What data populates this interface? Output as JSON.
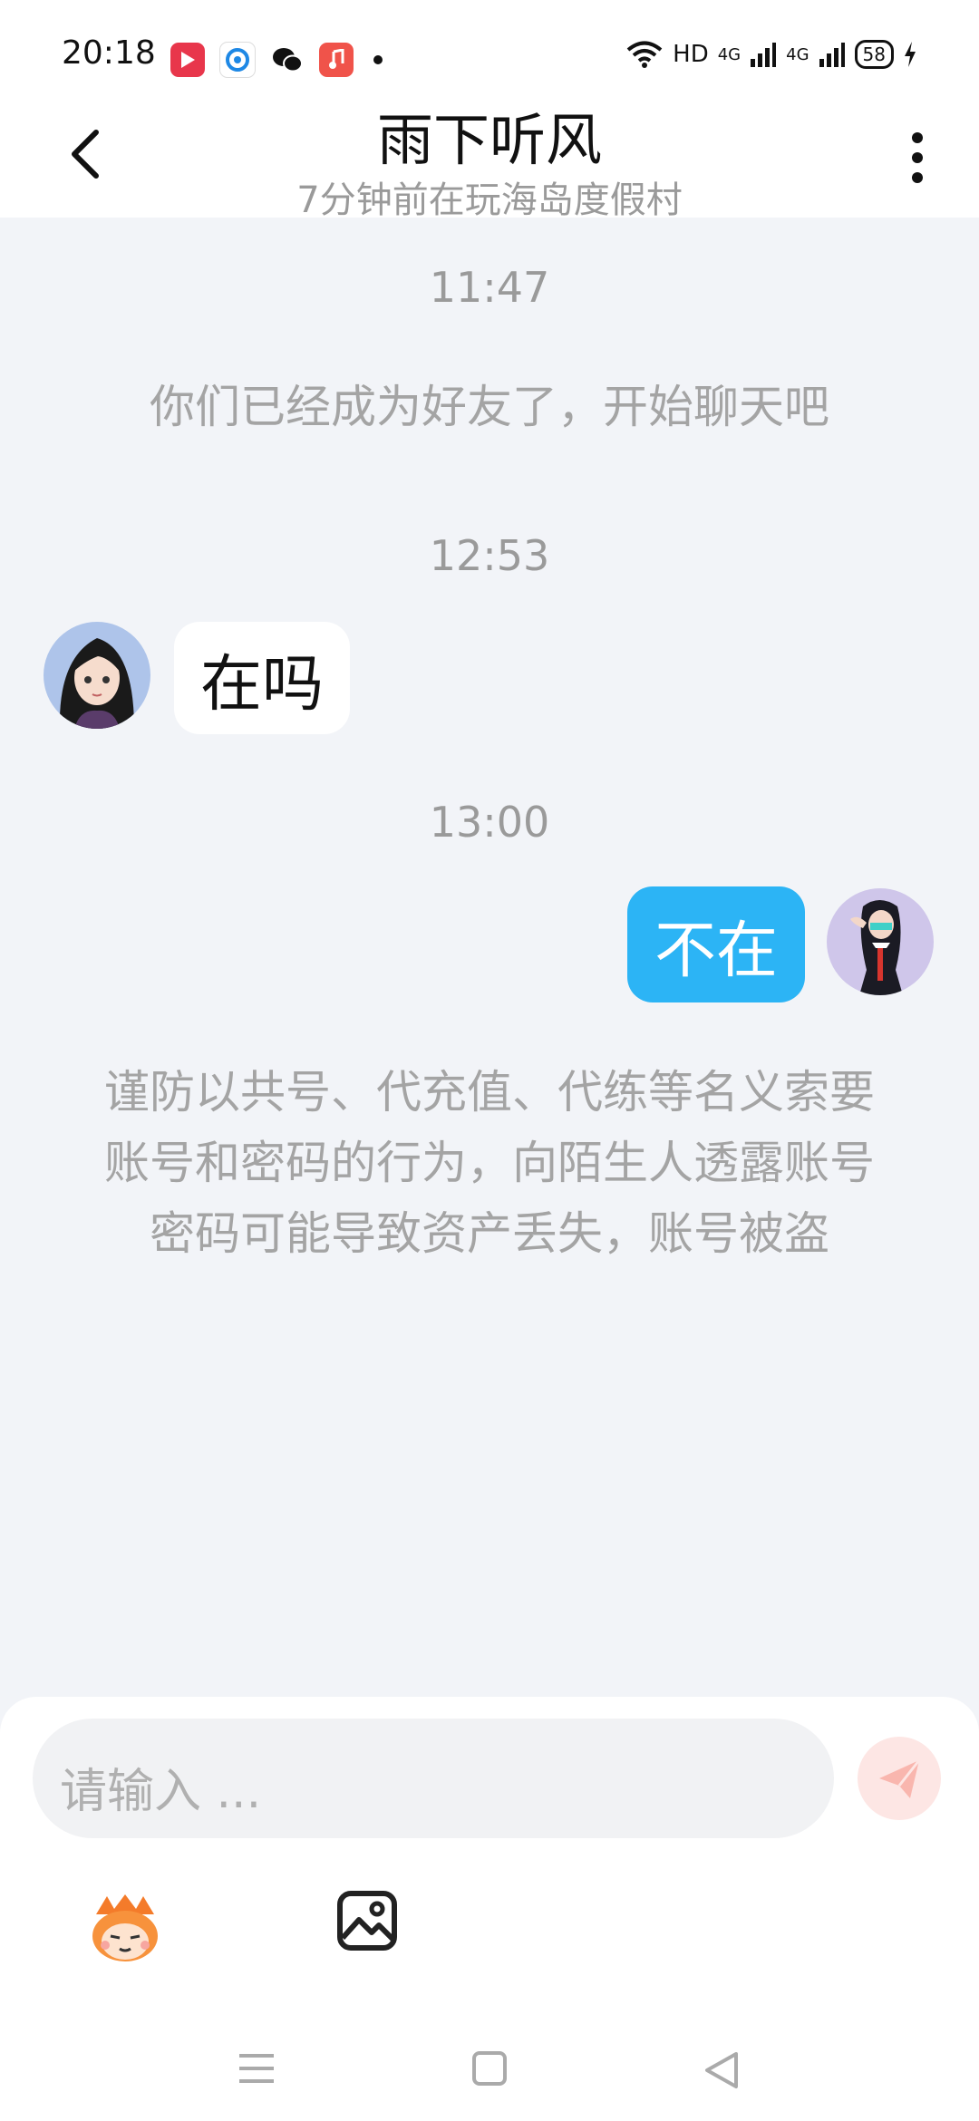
{
  "status_bar": {
    "time": "20:18",
    "network": "HD",
    "signal_1": "4G",
    "signal_2": "4G",
    "battery": "58",
    "app_icons": [
      "video-app-icon",
      "qq-browser-icon",
      "wechat-icon",
      "music-app-icon"
    ]
  },
  "header": {
    "title": "雨下听风",
    "subtitle": "7分钟前在玩海岛度假村"
  },
  "messages": [
    {
      "type": "timestamp",
      "text": "11:47"
    },
    {
      "type": "system",
      "text": "你们已经成为好友了，开始聊天吧"
    },
    {
      "type": "timestamp",
      "text": "12:53"
    },
    {
      "type": "incoming",
      "text": "在吗"
    },
    {
      "type": "timestamp",
      "text": "13:00"
    },
    {
      "type": "outgoing",
      "text": "不在"
    },
    {
      "type": "system",
      "text": "谨防以共号、代充值、代练等名义索要账号和密码的行为，向陌生人透露账号密码可能导致资产丢失，账号被盗"
    }
  ],
  "input": {
    "placeholder": "请输入 ..."
  },
  "colors": {
    "outgoing_bubble": "#2cb4f5",
    "send_button": "#fde6e4",
    "background": "#f2f4f8"
  }
}
